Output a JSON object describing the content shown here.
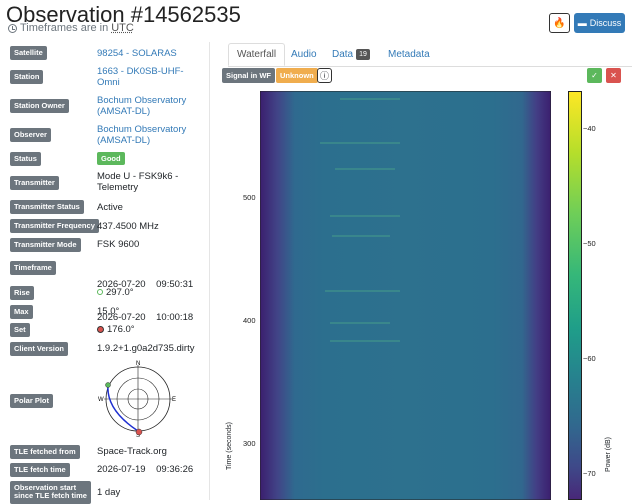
{
  "header": {
    "title": "Observation #14562535",
    "timeframes_text": "Timeframes are in",
    "utc": "UTC",
    "discuss_label": "Discuss"
  },
  "details": [
    {
      "label": "Satellite",
      "value": "98254 - SOLARAS",
      "link": true
    },
    {
      "label": "Station",
      "value_lines": [
        "1663 - DK0SB-UHF-",
        "Omni"
      ],
      "link": true
    },
    {
      "label": "Station Owner",
      "value_lines": [
        "Bochum Observatory",
        "(AMSAT-DL)"
      ],
      "link": true
    },
    {
      "label": "Observer",
      "value_lines": [
        "Bochum Observatory",
        "(AMSAT-DL)"
      ],
      "link": true
    },
    {
      "label": "Status",
      "badge": "Good"
    },
    {
      "label": "Transmitter",
      "value_lines": [
        "Mode U - FSK9k6 -",
        "Telemetry"
      ]
    },
    {
      "label": "Transmitter Status",
      "value": "Active"
    },
    {
      "label": "Transmitter Frequency",
      "value": "437.4500 MHz"
    },
    {
      "label": "Transmitter Mode",
      "value": "FSK 9600"
    },
    {
      "label": "Timeframe",
      "value_lines": [
        "2026-07-20    09:50:31",
        "2026-07-20    10:00:18"
      ]
    },
    {
      "label": "Rise",
      "value": "297.0°"
    },
    {
      "label": "Max",
      "value": "15.0°"
    },
    {
      "label": "Set",
      "value": "176.0°"
    },
    {
      "label": "Client Version",
      "value": "1.9.2+1.g0a2d735.dirty"
    },
    {
      "label": "Polar Plot"
    },
    {
      "label": "TLE fetched from",
      "value": "Space-Track.org"
    },
    {
      "label": "TLE fetch time",
      "value": "2026-07-19    09:36:26"
    },
    {
      "label_lines": [
        "Observation start",
        "since TLE fetch time"
      ],
      "value": "1 day"
    }
  ],
  "polar": {
    "n": "N",
    "s": "S",
    "e": "E",
    "w": "W"
  },
  "tabs": {
    "waterfall": "Waterfall",
    "audio": "Audio",
    "data": "Data",
    "data_count": "19",
    "metadata": "Metadata"
  },
  "waterfall": {
    "signal_label": "Signal in WF",
    "signal_status": "Unknown",
    "y_label": "Time (seconds)",
    "y_ticks": [
      "500",
      "400",
      "300"
    ],
    "colorbar_label": "Power (dB)",
    "colorbar_ticks": [
      "−40",
      "−50",
      "−60",
      "−70"
    ]
  },
  "colors": {
    "good": "#5cb85c",
    "unknown": "#f0ad4e",
    "label_bg": "#6c757d",
    "link": "#337ab7",
    "rise_dot": "#5cb85c",
    "set_dot": "#d9534f"
  }
}
